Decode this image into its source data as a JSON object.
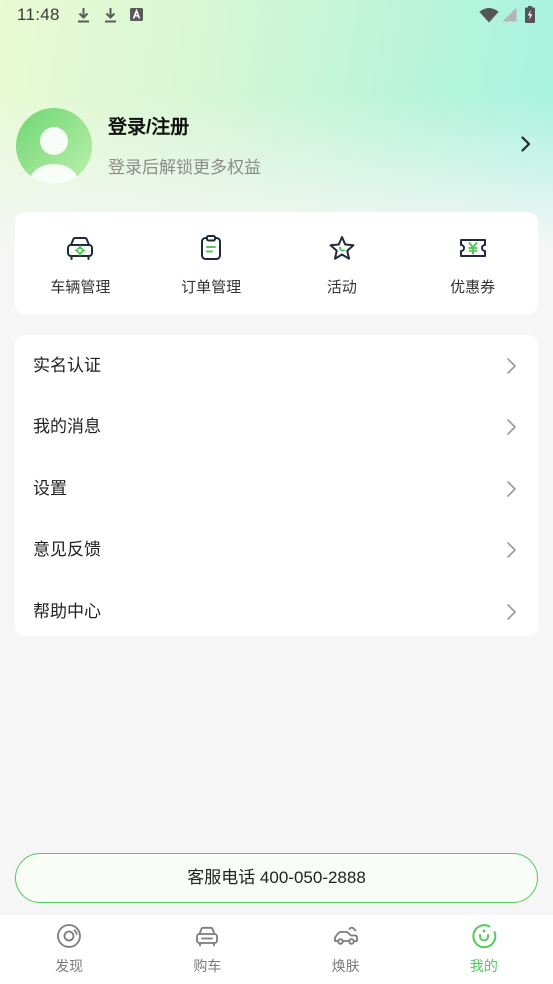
{
  "status_bar": {
    "time": "11:48",
    "left_icons": [
      "download-icon",
      "download-icon",
      "font-a-icon"
    ],
    "right_icons": [
      "wifi-icon",
      "cell-signal-icon",
      "battery-charging-icon"
    ]
  },
  "profile": {
    "title": "登录/注册",
    "subtitle": "登录后解锁更多权益",
    "avatar_icon": "default-avatar-icon"
  },
  "quick_actions": [
    {
      "label": "车辆管理",
      "icon": "car-manage-icon"
    },
    {
      "label": "订单管理",
      "icon": "order-clipboard-icon"
    },
    {
      "label": "活动",
      "icon": "star-activity-icon"
    },
    {
      "label": "优惠券",
      "icon": "coupon-ticket-icon"
    }
  ],
  "menu": [
    {
      "label": "实名认证"
    },
    {
      "label": "我的消息"
    },
    {
      "label": "设置"
    },
    {
      "label": "意见反馈"
    },
    {
      "label": "帮助中心"
    }
  ],
  "service": {
    "label": "客服电话 400-050-2888"
  },
  "tabs": [
    {
      "label": "发现",
      "icon": "discover-icon",
      "active": false
    },
    {
      "label": "购车",
      "icon": "car-front-icon",
      "active": false
    },
    {
      "label": "焕肤",
      "icon": "car-paint-icon",
      "active": false
    },
    {
      "label": "我的",
      "icon": "profile-icon",
      "active": true
    }
  ],
  "colors": {
    "accent": "#55c95b",
    "icon_dark": "#1f2b3a",
    "background": "#f6f6f6",
    "text_primary": "#1a1a1a",
    "text_secondary": "#8c8c8c"
  }
}
